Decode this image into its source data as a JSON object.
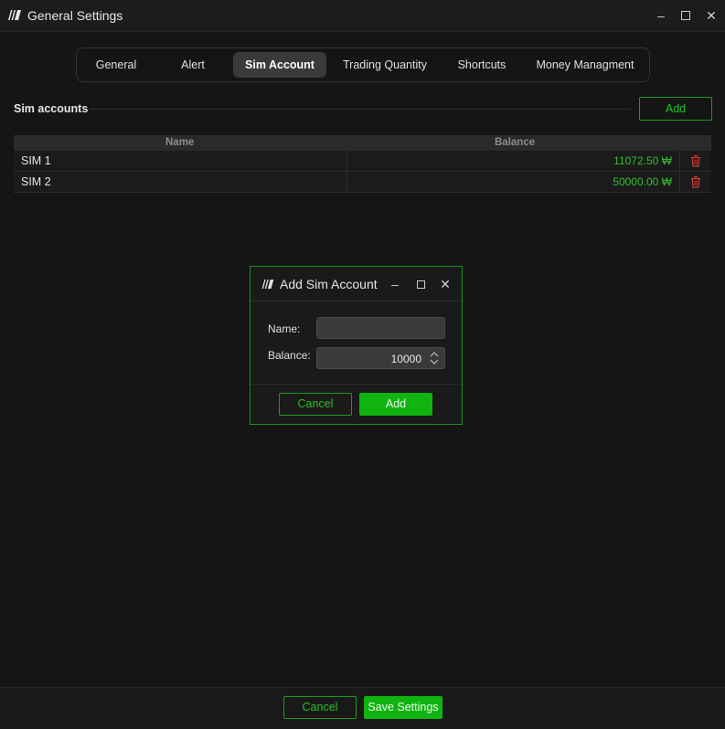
{
  "window": {
    "title": "General Settings",
    "minimize_icon": "minimize-icon",
    "maximize_icon": "maximize-icon",
    "close_icon": "close-icon"
  },
  "tabs": [
    {
      "label": "General",
      "active": false
    },
    {
      "label": "Alert",
      "active": false
    },
    {
      "label": "Sim Account",
      "active": true
    },
    {
      "label": "Trading Quantity",
      "active": false
    },
    {
      "label": "Shortcuts",
      "active": false
    },
    {
      "label": "Money Managment",
      "active": false
    }
  ],
  "section": {
    "label": "Sim accounts",
    "add_label": "Add"
  },
  "grid": {
    "columns": [
      "Name",
      "Balance"
    ],
    "rows": [
      {
        "name": "SIM 1",
        "balance": "11072.50 ₩"
      },
      {
        "name": "SIM 2",
        "balance": "50000.00 ₩"
      }
    ],
    "delete_icon": "trash-icon"
  },
  "dialog": {
    "title": "Add Sim Account",
    "name_label": "Name:",
    "name_value": "",
    "balance_label": "Balance:",
    "balance_value": "10000",
    "cancel_label": "Cancel",
    "add_label": "Add"
  },
  "footer": {
    "cancel_label": "Cancel",
    "save_label": "Save Settings"
  },
  "colors": {
    "accent": "#10b410",
    "positive": "#2fc12f",
    "danger": "#d03a3a",
    "background": "#151515"
  }
}
